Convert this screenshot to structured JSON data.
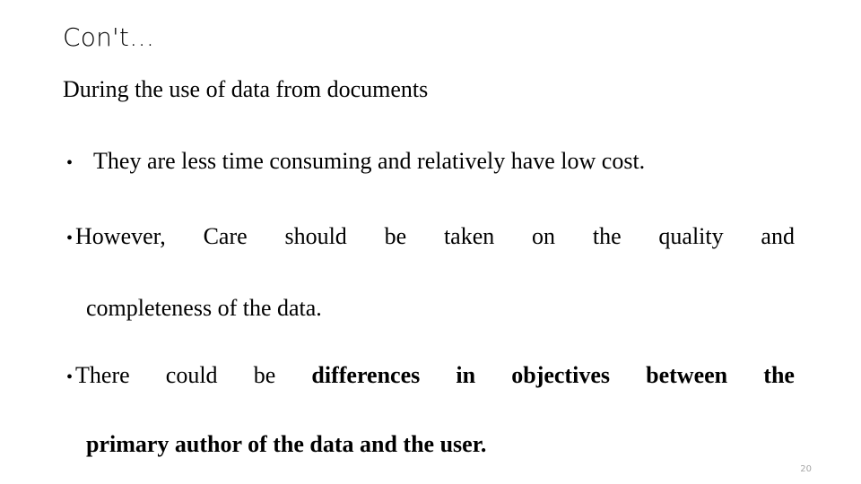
{
  "slide": {
    "title": "Con't…",
    "lead_line": "During the use of data from documents",
    "page_number": "20",
    "colors": {
      "background": "#ffffff",
      "text": "#000000",
      "page_number": "#a6a6a6"
    },
    "bullets": [
      {
        "marker": "•",
        "text": "They are less time consuming and relatively have low cost.",
        "line1_words": [
          "They",
          "are",
          "less",
          "time",
          "consuming",
          "and",
          "relatively",
          "have",
          "low",
          "cost."
        ],
        "justified": false
      },
      {
        "marker": "•",
        "text": "However,  Care  should  be  taken  on  the  quality  and completeness of the data.",
        "line1_words": [
          "However,",
          "Care",
          "should",
          "be",
          "taken",
          "on",
          "the",
          "quality",
          "and"
        ],
        "line2": "completeness of the data.",
        "justified": true
      },
      {
        "marker": "•",
        "text": "There  could  be  differences  in  objectives  between  the primary author of the data and the user.",
        "line1_words": [
          "There",
          "could",
          "be",
          "differences",
          "in",
          "objectives",
          "between",
          "the"
        ],
        "line1_bold_from_index": 3,
        "line2": "primary author of the data and the user.",
        "line2_bold": true,
        "justified": true
      }
    ]
  }
}
